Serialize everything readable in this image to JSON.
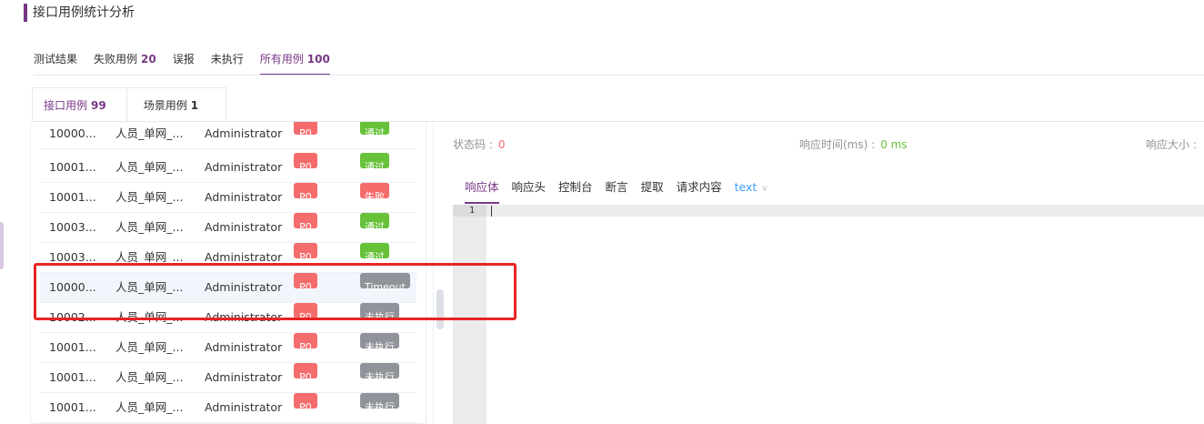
{
  "page_title": "接口用例统计分析",
  "top_tabs": [
    {
      "label": "测试结果",
      "count": ""
    },
    {
      "label": "失败用例",
      "count": "20"
    },
    {
      "label": "误报",
      "count": ""
    },
    {
      "label": "未执行",
      "count": ""
    },
    {
      "label": "所有用例",
      "count": "100"
    }
  ],
  "sub_tabs": [
    {
      "label": "接口用例",
      "count": "99"
    },
    {
      "label": "场景用例",
      "count": "1"
    }
  ],
  "rows": [
    {
      "id": "10000...",
      "name": "人员_单网_...",
      "user": "Administrator",
      "priority": "P0",
      "status": "通过"
    },
    {
      "id": "10001...",
      "name": "人员_单网_...",
      "user": "Administrator",
      "priority": "P0",
      "status": "通过"
    },
    {
      "id": "10001...",
      "name": "人员_单网_...",
      "user": "Administrator",
      "priority": "P0",
      "status": "失败"
    },
    {
      "id": "10003...",
      "name": "人员_单网_...",
      "user": "Administrator",
      "priority": "P0",
      "status": "通过"
    },
    {
      "id": "10003...",
      "name": "人员_单网_...",
      "user": "Administrator",
      "priority": "P0",
      "status": "通过"
    },
    {
      "id": "10000...",
      "name": "人员_单网_...",
      "user": "Administrator",
      "priority": "P0",
      "status": "Timeout"
    },
    {
      "id": "10002...",
      "name": "人员_单网_...",
      "user": "Administrator",
      "priority": "P0",
      "status": "未执行"
    },
    {
      "id": "10001...",
      "name": "人员_单网_...",
      "user": "Administrator",
      "priority": "P0",
      "status": "未执行"
    },
    {
      "id": "10001...",
      "name": "人员_单网_...",
      "user": "Administrator",
      "priority": "P0",
      "status": "未执行"
    },
    {
      "id": "10001...",
      "name": "人员_单网_...",
      "user": "Administrator",
      "priority": "P0",
      "status": "未执行"
    }
  ],
  "detail": {
    "status_code_label": "状态码 :",
    "status_code_value": "0",
    "response_time_label": "响应时间(ms) :",
    "response_time_value": "0 ms",
    "response_size_label": "响应大小 :",
    "tabs": [
      "响应体",
      "响应头",
      "控制台",
      "断言",
      "提取",
      "请求内容"
    ],
    "format": "text",
    "line_number": "1"
  },
  "colors": {
    "accent": "#783887",
    "pass": "#67c23a",
    "fail": "#f56c6c",
    "neutral": "#909399",
    "annotation": "#e82424"
  }
}
